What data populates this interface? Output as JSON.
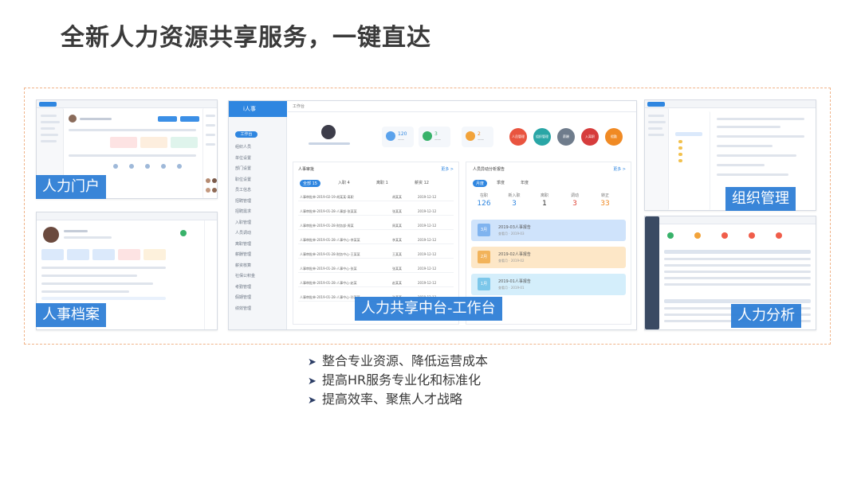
{
  "title": "全新人力资源共享服务，一键直达",
  "captions": {
    "portal": "人力门户",
    "archive": "人事档案",
    "workbench": "人力共享中台-工作台",
    "org": "组织管理",
    "analysis": "人力分析"
  },
  "bullets": [
    "整合专业资源、降低运营成本",
    "提高HR服务专业化和标准化",
    "提高效率、聚焦人才战略"
  ],
  "workbench": {
    "app_name": "i人事",
    "header": "工作台",
    "active_nav": "工作台",
    "nav": [
      "组织人员",
      "单位设置",
      "部门设置",
      "职位设置",
      "员工信息",
      "招聘管理",
      "招聘需求",
      "入职管理",
      "人员调动",
      "离职管理",
      "薪酬管理",
      "薪资核算",
      "社保公积金",
      "考勤管理",
      "假期管理",
      "绩效管理"
    ],
    "bubbles": [
      "人员管理",
      "组织管理",
      "薪酬",
      "入离职",
      "假勤"
    ],
    "todo": {
      "title": "人事审批",
      "more": "更多 >",
      "tabs": [
        {
          "label": "全部 15"
        },
        {
          "label": "入职 4"
        },
        {
          "label": "离职 1"
        },
        {
          "label": "薪资 12"
        }
      ],
      "rows": [
        [
          "人事审批单-2019-02-19-胡某某-离职",
          "胡某某",
          "2019-12-12"
        ],
        [
          "人事审批单-2019-01-28-人事部-张某某",
          "张某某",
          "2019-12-12"
        ],
        [
          "人事审批单-2019-01-28-财务部-周某",
          "周某某",
          "2019-12-12"
        ],
        [
          "人事审批单-2019-01-28-人事中心-李某某",
          "李某某",
          "2019-12-12"
        ],
        [
          "人事审批单-2019-01-28-财务中心-王某某",
          "王某某",
          "2019-12-12"
        ],
        [
          "人事审批单-2019-01-28-人事中心-张某",
          "张某某",
          "2019-12-12"
        ],
        [
          "人事审批单-2019-01-28-人事中心-赵某",
          "赵某某",
          "2019-12-12"
        ],
        [
          "人事审批单-2019-01-28-人事中心-孙某某",
          "孙某某",
          "2019-12-12"
        ]
      ]
    },
    "report": {
      "title": "人员异动分析报告",
      "more": "更多 >",
      "tabs": [
        "月度",
        "季度",
        "年度"
      ],
      "stats": [
        {
          "label": "在职",
          "value": "126",
          "color": "#2f86e0"
        },
        {
          "label": "新入职",
          "value": "3",
          "color": "#2f86e0"
        },
        {
          "label": "离职",
          "value": "1",
          "color": "#333333"
        },
        {
          "label": "调动",
          "value": "3",
          "color": "#e0463a"
        },
        {
          "label": "转正",
          "value": "33",
          "color": "#f08a24"
        }
      ],
      "cards": [
        {
          "title": "2019-03人事报告",
          "sub": "查看月 · 2019-03",
          "color": "#cfe3fb",
          "icon": "#7fb3ef",
          "icon_label": "3月"
        },
        {
          "title": "2019-02人事报告",
          "sub": "查看月 · 2019-02",
          "color": "#fde7c7",
          "icon": "#f2b35a",
          "icon_label": "2月"
        },
        {
          "title": "2019-01人事报告",
          "sub": "查看月 · 2019-01",
          "color": "#d4eefb",
          "icon": "#7cc7ea",
          "icon_label": "1月"
        }
      ]
    }
  }
}
